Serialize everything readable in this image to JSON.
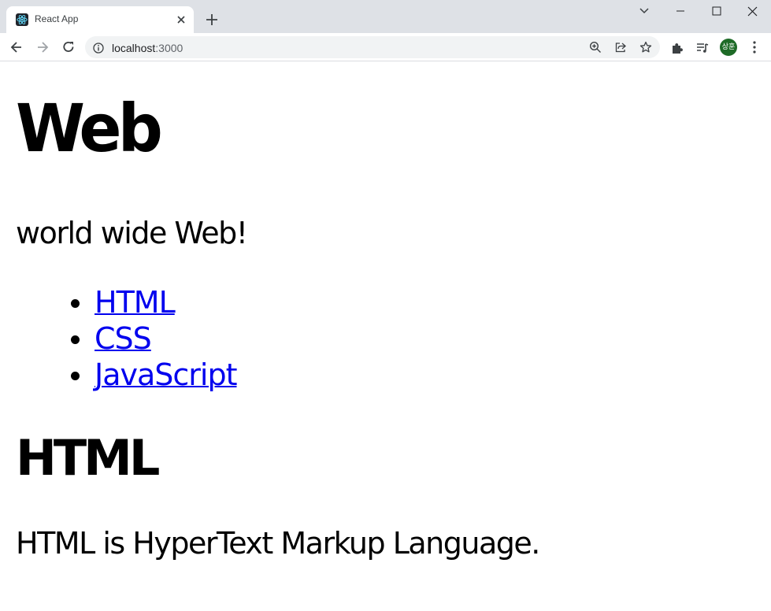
{
  "browser": {
    "tab": {
      "title": "React App",
      "favicon": "react-logo-icon"
    },
    "url": {
      "host": "localhost",
      "port": ":3000"
    },
    "profile": {
      "avatar_text": "상훈",
      "avatar_color": "#1e6b27"
    },
    "icons": [
      "back-arrow-icon",
      "forward-arrow-icon",
      "reload-icon",
      "info-icon",
      "zoom-icon",
      "share-icon",
      "star-icon",
      "extensions-icon",
      "media-icon",
      "more-menu-icon"
    ]
  },
  "page": {
    "title": "Web",
    "subtitle": "world wide Web!",
    "nav": [
      {
        "label": "HTML"
      },
      {
        "label": "CSS"
      },
      {
        "label": "JavaScript"
      }
    ],
    "article": {
      "heading": "HTML",
      "body": "HTML is HyperText Markup Language."
    },
    "colors": {
      "link": "#0000ee",
      "text": "#000000",
      "background": "#ffffff"
    }
  }
}
